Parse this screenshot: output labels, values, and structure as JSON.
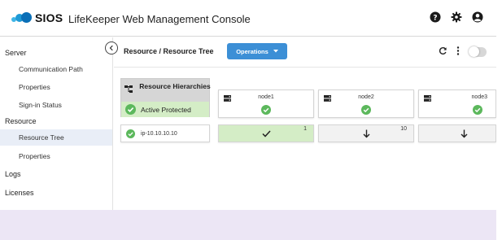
{
  "header": {
    "logo_text": "SIOS",
    "title": "LifeKeeper Web Management Console",
    "icons": [
      "help-icon",
      "settings-gear-icon",
      "user-account-icon"
    ]
  },
  "sidebar": {
    "groups": [
      {
        "label": "Server",
        "items": [
          {
            "label": "Communication Path"
          },
          {
            "label": "Properties"
          },
          {
            "label": "Sign-in Status"
          }
        ]
      },
      {
        "label": "Resource",
        "items": [
          {
            "label": "Resource Tree",
            "active": true
          },
          {
            "label": "Properties"
          }
        ]
      },
      {
        "label": "Logs",
        "items": []
      },
      {
        "label": "Licenses",
        "items": []
      }
    ],
    "collapse_icon": "chevron-left-icon"
  },
  "main": {
    "breadcrumb": "Resource / Resource Tree",
    "operations_label": "Operations",
    "toolbar_icons": [
      "refresh-icon",
      "more-vertical-icon",
      "toggle-switch"
    ],
    "toggle_on": false,
    "hierarchy": {
      "title": "Resource Hierarchies",
      "status": "Active Protected",
      "status_color": "#d4edc6"
    },
    "nodes": [
      {
        "name": "node1",
        "status": "ok"
      },
      {
        "name": "node2",
        "status": "ok"
      },
      {
        "name": "node3",
        "status": "ok"
      }
    ],
    "resources": [
      {
        "name": "ip-10.10.10.10",
        "status": "ok",
        "states": [
          {
            "icon": "checkmark-icon",
            "priority": "1",
            "color": "#d4edc6"
          },
          {
            "icon": "arrow-down-icon",
            "priority": "10",
            "color": "#f2f2f2"
          },
          {
            "icon": "arrow-down-icon",
            "priority": "",
            "color": "#f2f2f2"
          }
        ]
      }
    ]
  },
  "colors": {
    "accent": "#3c8fd6",
    "success": "#5cb85c",
    "active_bg": "#d4edc6",
    "footer_bg": "#ece6f5"
  }
}
